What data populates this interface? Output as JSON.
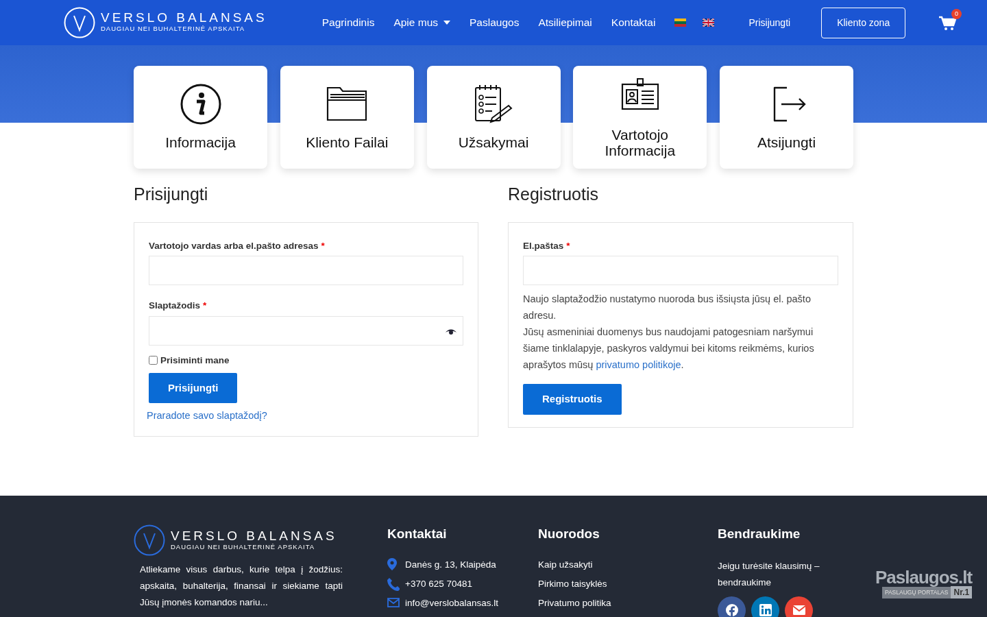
{
  "header": {
    "logo": {
      "title": "VERSLO BALANSAS",
      "subtitle": "DAUGIAU NEI BUHALTERINĖ APSKAITA"
    },
    "nav": [
      {
        "label": "Pagrindinis",
        "dropdown": false
      },
      {
        "label": "Apie mus",
        "dropdown": true
      },
      {
        "label": "Paslaugos",
        "dropdown": false
      },
      {
        "label": "Atsiliepimai",
        "dropdown": false
      },
      {
        "label": "Kontaktai",
        "dropdown": false
      }
    ],
    "languages": [
      {
        "kind": "lt"
      },
      {
        "kind": "en"
      }
    ],
    "login_link": "Prisijungti",
    "client_zone_button": "Kliento zona",
    "cart_count": "0"
  },
  "tiles": [
    {
      "label": "Informacija",
      "kind": "info"
    },
    {
      "label": "Kliento Failai",
      "kind": "folder"
    },
    {
      "label": "Užsakymai",
      "kind": "checklist"
    },
    {
      "label": "Vartotojo Informacija",
      "kind": "id-card"
    },
    {
      "label": "Atsijungti",
      "kind": "logout"
    }
  ],
  "login": {
    "title": "Prisijungti",
    "fields": [
      {
        "label": "Vartotojo vardas arba el.pašto adresas",
        "required_mark": "*",
        "kind": "text"
      },
      {
        "label": "Slaptažodis",
        "required_mark": "*",
        "kind": "password"
      }
    ],
    "remember": {
      "label": "Prisiminti mane",
      "checked": false
    },
    "button": "Prisijungti",
    "lost_password_link": "Praradote savo slaptažodį?"
  },
  "register": {
    "title": "Registruotis",
    "fields": [
      {
        "label": "El.paštas",
        "required_mark": "*"
      }
    ],
    "notice": "Naujo slaptažodžio nustatymo nuoroda bus išsiųsta jūsų el. pašto adresu.",
    "privacy": {
      "before": "Jūsų asmeniniai duomenys bus naudojami patogesniam naršymui šiame tinklalapyje, paskyros valdymui bei kitoms reikmėms, kurios aprašytos mūsų",
      "link": "privatumo politikoje",
      "after": "."
    },
    "button": "Registruotis"
  },
  "footer": {
    "logo": {
      "title": "VERSLO BALANSAS",
      "subtitle": "DAUGIAU NEI BUHALTERINĖ APSKAITA"
    },
    "about": "Atliekame visus darbus, kurie telpa į žodžius: apskaita, buhalterija, finansai ir siekiame tapti Jūsų įmonės komandos nariu...",
    "contacts_title": "Kontaktai",
    "contacts": [
      {
        "kind": "address",
        "text": "Danės g. 13, Klaipėda"
      },
      {
        "kind": "phone",
        "text": "+370 625 70481"
      },
      {
        "kind": "email",
        "text": "info@verslobalansas.lt"
      }
    ],
    "links_title": "Nuorodos",
    "links": [
      "Kaip užsakyti",
      "Pirkimo taisyklės",
      "Privatumo politika"
    ],
    "social_title": "Bendraukime",
    "social_text": "Jeigu turėsite klausimų – bendraukime",
    "social": [
      {
        "kind": "facebook",
        "color": "#3b5998"
      },
      {
        "kind": "linkedin",
        "color": "#0077b5"
      },
      {
        "kind": "email",
        "color": "#ea4335"
      }
    ],
    "badge": {
      "title": "Paslaugos.lt",
      "subtitle": "PASLAUGŲ PORTALAS",
      "rank": "Nr.1"
    }
  }
}
